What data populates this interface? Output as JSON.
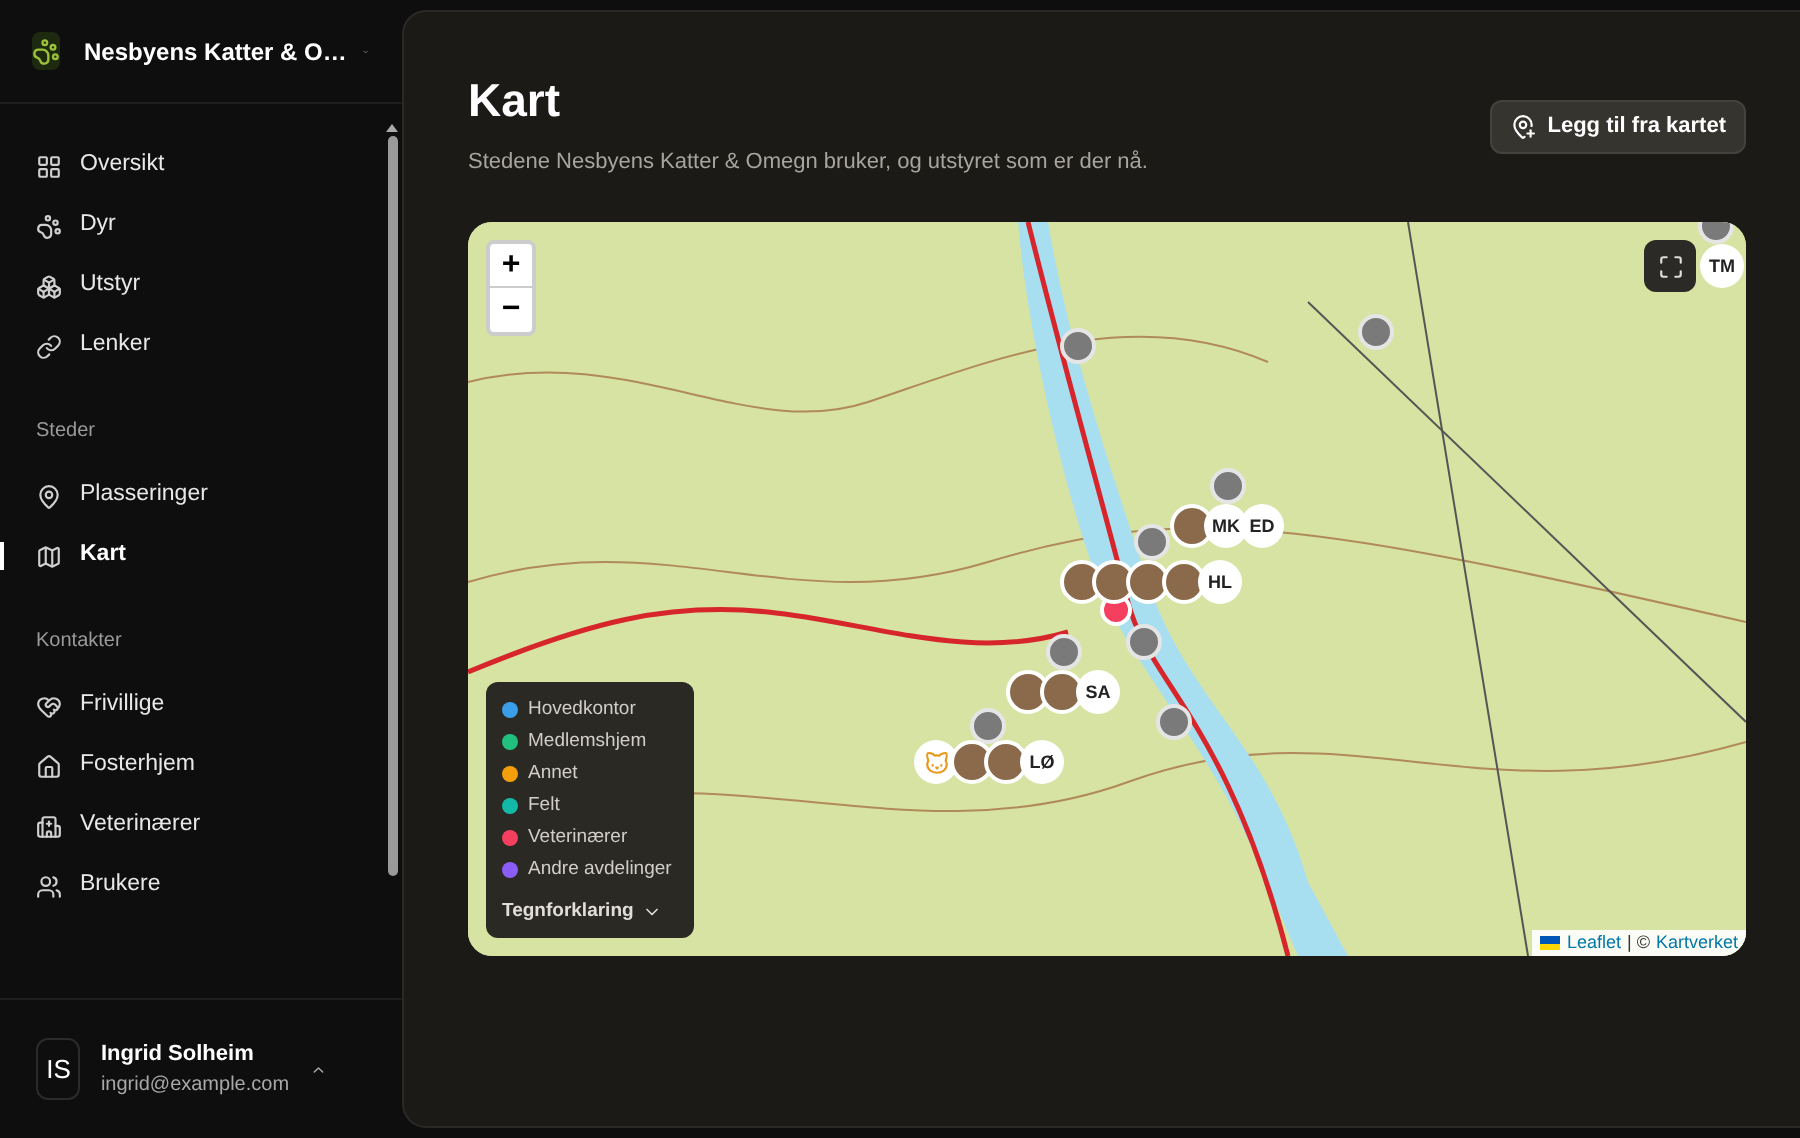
{
  "sidebar": {
    "org_name": "Nesbyens Katter & O…",
    "groups": [
      {
        "items": [
          {
            "label": "Oversikt",
            "selected": false
          },
          {
            "label": "Dyr",
            "selected": false
          },
          {
            "label": "Utstyr",
            "selected": false
          },
          {
            "label": "Lenker",
            "selected": false
          }
        ]
      },
      {
        "heading": "Steder",
        "items": [
          {
            "label": "Plasseringer",
            "selected": false
          },
          {
            "label": "Kart",
            "selected": true
          }
        ]
      },
      {
        "heading": "Kontakter",
        "items": [
          {
            "label": "Frivillige",
            "selected": false
          },
          {
            "label": "Fosterhjem",
            "selected": false
          },
          {
            "label": "Veterinærer",
            "selected": false
          },
          {
            "label": "Brukere",
            "selected": false
          }
        ]
      }
    ],
    "user": {
      "initials": "IS",
      "name": "Ingrid Solheim",
      "email": "ingrid@example.com"
    }
  },
  "page": {
    "title": "Kart",
    "subtitle": "Stedene Nesbyens Katter & Omegn bruker, og utstyret som er der nå.",
    "add_button": "Legg til fra kartet"
  },
  "map": {
    "zoom_in": "+",
    "zoom_out": "−",
    "markers": [
      {
        "kind": "dot"
      },
      {
        "kind": "dot"
      },
      {
        "kind": "dot"
      },
      {
        "kind": "dot"
      },
      {
        "kind": "dot"
      },
      {
        "kind": "dot"
      },
      {
        "kind": "dot"
      },
      {
        "kind": "dot"
      },
      {
        "kind": "dot"
      },
      {
        "kind": "vet"
      },
      {
        "kind": "photo"
      },
      {
        "kind": "initials",
        "text": "MK"
      },
      {
        "kind": "initials",
        "text": "ED"
      },
      {
        "kind": "photo"
      },
      {
        "kind": "photo"
      },
      {
        "kind": "photo"
      },
      {
        "kind": "photo"
      },
      {
        "kind": "initials",
        "text": "HL"
      },
      {
        "kind": "photo"
      },
      {
        "kind": "photo"
      },
      {
        "kind": "initials",
        "text": "SA"
      },
      {
        "kind": "cat"
      },
      {
        "kind": "photo"
      },
      {
        "kind": "photo"
      },
      {
        "kind": "initials",
        "text": "LØ"
      },
      {
        "kind": "initials",
        "text": "TM"
      }
    ],
    "legend": {
      "items": [
        {
          "label": "Hovedkontor",
          "color": "#3b9ee8"
        },
        {
          "label": "Medlemshjem",
          "color": "#22c07e"
        },
        {
          "label": "Annet",
          "color": "#f59e0b"
        },
        {
          "label": "Felt",
          "color": "#14b8a6"
        },
        {
          "label": "Veterinærer",
          "color": "#f43f5e"
        },
        {
          "label": "Andre avdelinger",
          "color": "#8b5cf6"
        }
      ],
      "toggle": "Tegnforklaring",
      "expanded": true
    },
    "attribution": {
      "leaflet": "Leaflet",
      "separator": "| ©",
      "provider": "Kartverket"
    }
  }
}
